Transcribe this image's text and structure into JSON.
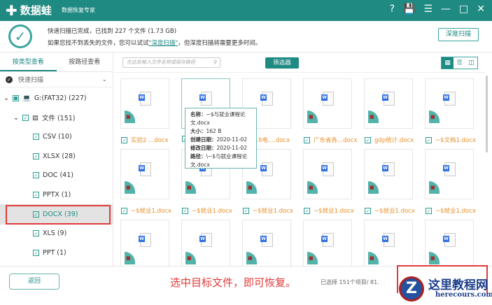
{
  "app": {
    "name": "数据蛙",
    "subtitle": "数据恢复专家"
  },
  "window_controls": [
    "?",
    "💾",
    "☰",
    "—",
    "□",
    "✕"
  ],
  "header": {
    "status": "快速扫描已完成，已找到 227 个文件 (1.73 GB)",
    "hint_prefix": "如果您找不到丢失的文件，您可以试试",
    "hint_link": "\"深度扫描\"",
    "hint_suffix": "，但深度扫描将需要更多时间。",
    "deep_scan_button": "深度扫描"
  },
  "sidebar": {
    "tabs": [
      "按类型查看",
      "按路径查看"
    ],
    "scan_mode": "快速扫描",
    "drive": "G:(FAT32) (227)",
    "folder": "文件 (151)",
    "types": [
      "CSV (10)",
      "XLSX (28)",
      "DOC (41)",
      "PPTX (1)",
      "DOCX (39)",
      "XLS (9)",
      "PPT (1)"
    ]
  },
  "toolbar": {
    "search_placeholder": "在此处输入文件名称或保存路径",
    "filter_button": "筛选器"
  },
  "files": {
    "row1": [
      "实验2 ...docx",
      "",
      "...6电....docx",
      "广东省各...docx",
      "gdp统计.docx",
      "~$文档1.docx"
    ],
    "row2": [
      "~$就业1.docx",
      "~$就业1.docx",
      "~$就业1.docx",
      "~$就业1.docx",
      "~$就业1.docx",
      "~$就业1.docx"
    ]
  },
  "tooltip": {
    "name_label": "名称：",
    "name": "~$与就业课程论文.docx",
    "size_label": "大小：",
    "size": "162 B",
    "created_label": "创建日期：",
    "created": "2020-11-02",
    "modified_label": "修改日期：",
    "modified": "2020-11-02",
    "path_label": "路径：",
    "path": "\\~$与就业课程论文.docx"
  },
  "footer": {
    "back_button": "返回",
    "annotation": "选中目标文件，即可恢复。",
    "selection_info": "已选择 151个项目/ 81.",
    "watermark_title": "这里教程网",
    "watermark_url": "herecours.com"
  },
  "colors": {
    "primary": "#1f8a82",
    "highlight": "#e23a3a",
    "file_label": "#e8902c"
  }
}
